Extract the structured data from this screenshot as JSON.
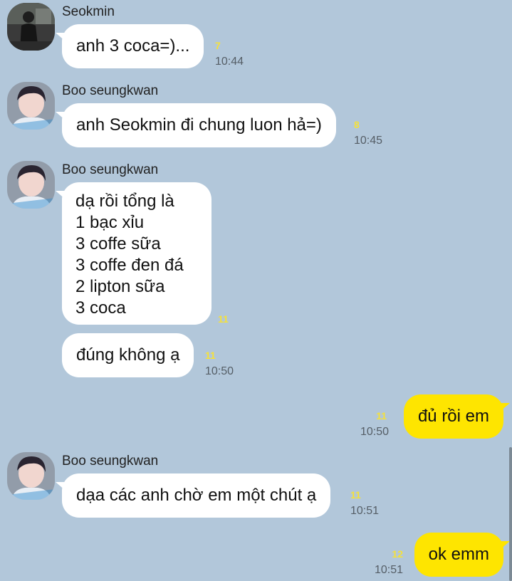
{
  "messages": [
    {
      "sender": "Seokmin",
      "text": "anh 3 coca=)...",
      "unread": "7",
      "time": "10:44"
    },
    {
      "sender": "Boo seungkwan",
      "text": "anh Seokmin đi chung luon hả=)",
      "unread": "8",
      "time": "10:45"
    },
    {
      "sender": "Boo seungkwan",
      "lines": [
        "dạ rồi tổng là",
        "1 bạc xỉu",
        "3 coffe sữa",
        "3 coffe đen đá",
        "2 lipton sữa",
        "3 coca"
      ],
      "unread": "11"
    },
    {
      "text": "đúng không ạ",
      "unread": "11",
      "time": "10:50"
    },
    {
      "from_me": true,
      "text": "đủ rồi em",
      "unread": "11",
      "time": "10:50"
    },
    {
      "sender": "Boo seungkwan",
      "text": "dạa các anh chờ em một chút ạ",
      "unread": "11",
      "time": "10:51"
    },
    {
      "from_me": true,
      "text": "ok emm",
      "unread": "12",
      "time": "10:51"
    }
  ],
  "colors": {
    "background": "#b2c7da",
    "bubble_other": "#ffffff",
    "bubble_me": "#fee500",
    "unread_count": "#f5e13a"
  }
}
